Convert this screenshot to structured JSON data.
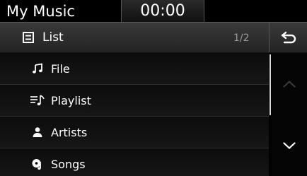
{
  "app": {
    "title": "My Music",
    "clock": "00:00"
  },
  "header": {
    "title": "List",
    "page_indicator": "1/2",
    "icon": "list-icon",
    "back_icon": "back-arrow-icon"
  },
  "list": {
    "items": [
      {
        "label": "File",
        "icon": "music-note-icon"
      },
      {
        "label": "Playlist",
        "icon": "playlist-icon"
      },
      {
        "label": "Artists",
        "icon": "artist-icon"
      },
      {
        "label": "Songs",
        "icon": "songs-icon"
      }
    ]
  },
  "scroll": {
    "up_icon": "chevron-up-icon",
    "down_icon": "chevron-down-icon",
    "up_enabled": false,
    "down_enabled": true
  },
  "colors": {
    "background": "#000000",
    "header": "#2e2e2e",
    "text": "#ffffff",
    "dim_text": "#9a9a9a",
    "disabled_icon": "#3a3a3a"
  }
}
